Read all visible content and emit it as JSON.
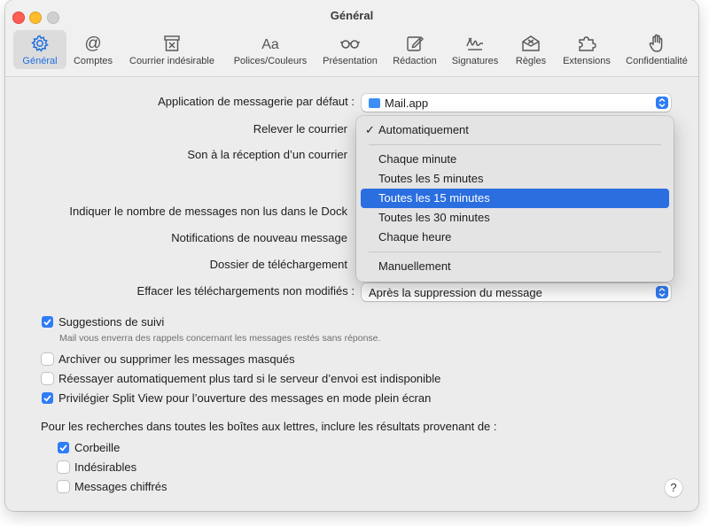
{
  "window": {
    "title": "Général"
  },
  "toolbar": {
    "tabs": [
      {
        "label": "Général",
        "icon": "gear-icon"
      },
      {
        "label": "Comptes",
        "icon": "at-icon"
      },
      {
        "label": "Courrier indésirable",
        "icon": "junk-mail-icon"
      },
      {
        "label": "Polices/Couleurs",
        "icon": "fonts-icon"
      },
      {
        "label": "Présentation",
        "icon": "glasses-icon"
      },
      {
        "label": "Rédaction",
        "icon": "compose-icon"
      },
      {
        "label": "Signatures",
        "icon": "signature-icon"
      },
      {
        "label": "Règles",
        "icon": "rules-icon"
      },
      {
        "label": "Extensions",
        "icon": "puzzle-icon"
      },
      {
        "label": "Confidentialité",
        "icon": "hand-icon"
      }
    ],
    "selected_tab": "Général"
  },
  "settings": {
    "default_app_label": "Application de messagerie par défaut :",
    "default_app_value": "Mail.app",
    "check_mail_label": "Relever le courrier",
    "new_mail_sound_label": "Son à la réception d’un courrier",
    "dock_unread_label": "Indiquer le nombre de messages non lus dans le Dock",
    "notifications_label": "Notifications de nouveau message",
    "downloads_folder_label": "Dossier de téléchargement",
    "remove_downloads_label": "Effacer les téléchargements non modifiés :",
    "remove_downloads_value": "Après la suppression du message"
  },
  "check_mail_menu": {
    "checked_item": "Automatiquement",
    "items": [
      "Chaque minute",
      "Toutes les 5 minutes",
      "Toutes les 15 minutes",
      "Toutes les 30 minutes",
      "Chaque heure"
    ],
    "highlighted_item": "Toutes les 15 minutes",
    "last_item": "Manuellement"
  },
  "checkboxes": {
    "follow_up": {
      "label": "Suggestions de suivi",
      "checked": true,
      "hint": "Mail vous enverra des rappels concernant les messages restés sans réponse."
    },
    "archive_muted": {
      "label": "Archiver ou supprimer les messages masqués",
      "checked": false
    },
    "retry_send": {
      "label": "Réessayer automatiquement plus tard si le serveur d’envoi est indisponible",
      "checked": false
    },
    "split_view": {
      "label": "Privilégier Split View pour l’ouverture des messages en mode plein écran",
      "checked": true
    }
  },
  "search": {
    "heading": "Pour les recherches dans toutes les boîtes aux lettres, inclure les résultats provenant de :",
    "trash": {
      "label": "Corbeille",
      "checked": true
    },
    "junk": {
      "label": "Indésirables",
      "checked": false
    },
    "encrypted": {
      "label": "Messages chiffrés",
      "checked": false
    }
  },
  "help": {
    "label": "?"
  },
  "colors": {
    "accent": "#2f7cf6",
    "highlight": "#2a6ee0"
  }
}
